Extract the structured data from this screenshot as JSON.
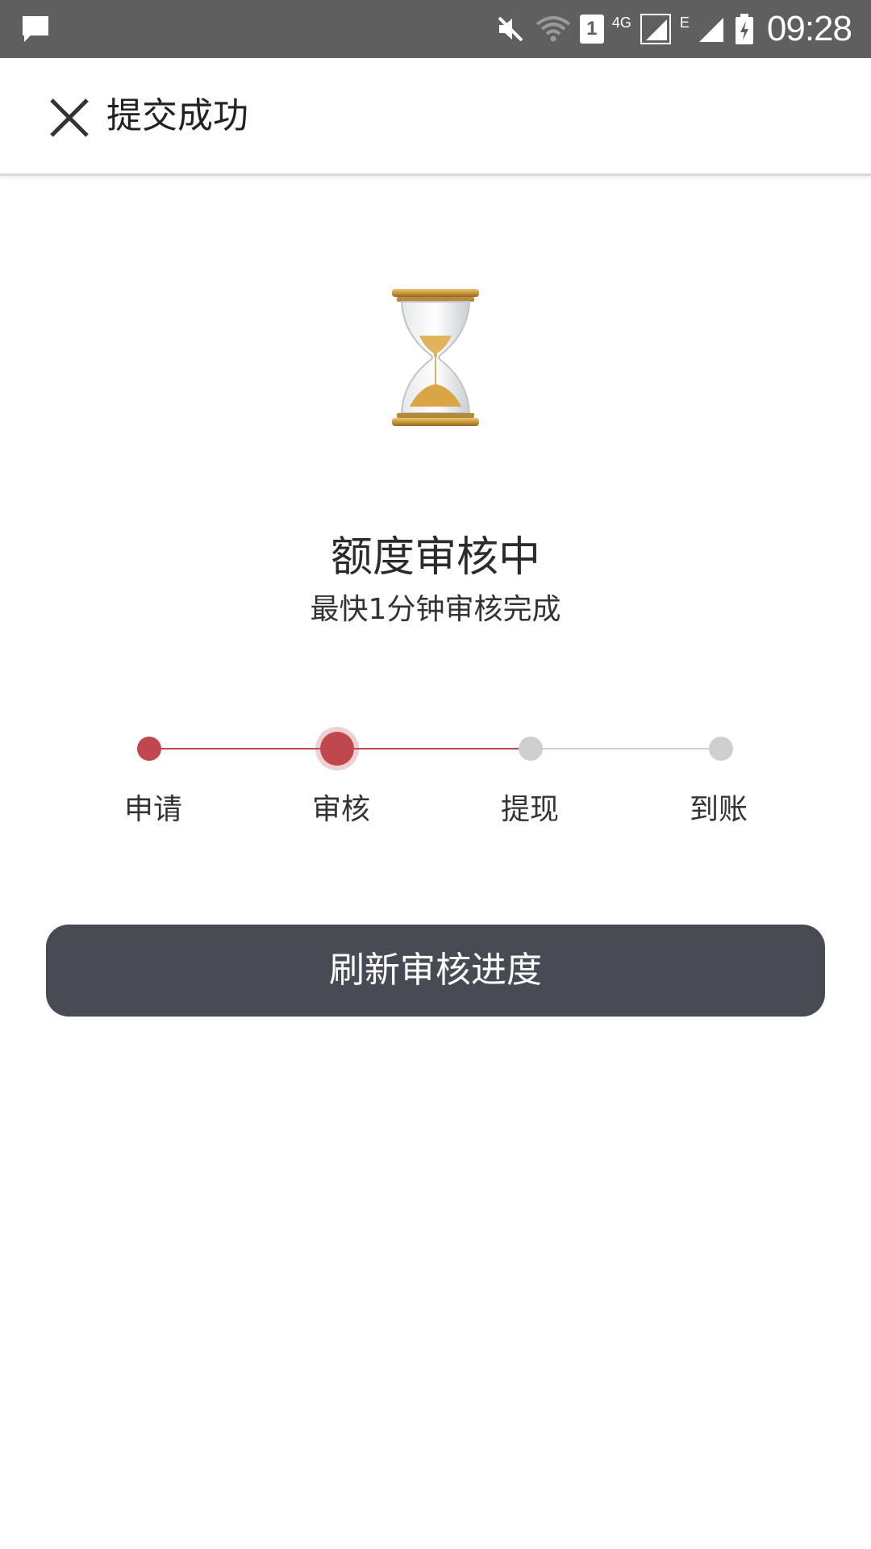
{
  "status_bar": {
    "time": "09:28",
    "sim_slot": "1",
    "network_4g": "4G",
    "network_e": "E",
    "icons": [
      "message-icon",
      "mute-icon",
      "wifi-icon",
      "sim-icon",
      "signal-icon",
      "battery-icon"
    ]
  },
  "header": {
    "title": "提交成功",
    "close_icon": "close-icon"
  },
  "status": {
    "title": "额度审核中",
    "subtitle": "最快1分钟审核完成"
  },
  "steps": [
    {
      "label": "申请",
      "state": "done"
    },
    {
      "label": "审核",
      "state": "active"
    },
    {
      "label": "提现",
      "state": "todo"
    },
    {
      "label": "到账",
      "state": "todo"
    }
  ],
  "actions": {
    "refresh_label": "刷新审核进度"
  },
  "colors": {
    "accent": "#c0474d",
    "inactive": "#cfcfcf",
    "button_bg": "#464b54",
    "status_bar_bg": "#5f5f5f"
  }
}
